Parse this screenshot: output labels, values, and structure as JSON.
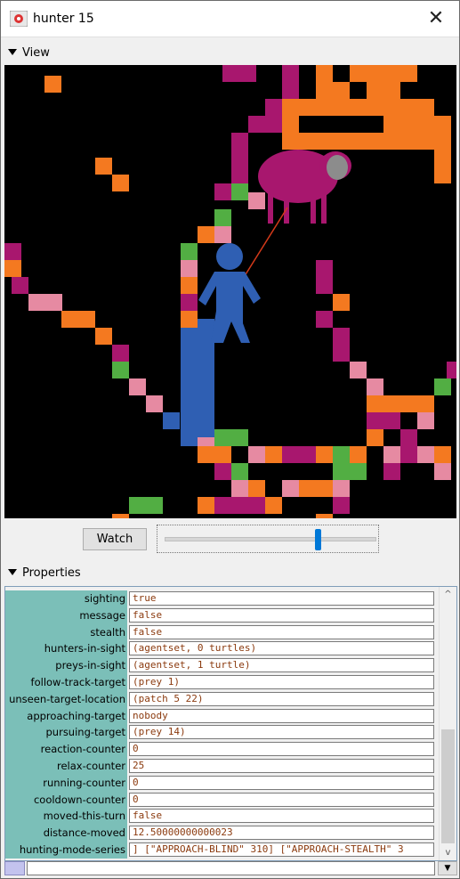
{
  "window": {
    "title": "hunter 15",
    "close_label": "✕"
  },
  "view_section": {
    "label": "View"
  },
  "controls": {
    "watch_label": "Watch",
    "slider_value": 0.73
  },
  "properties_section": {
    "label": "Properties"
  },
  "properties": [
    {
      "name": "sighting",
      "value": "true"
    },
    {
      "name": "message",
      "value": "false"
    },
    {
      "name": "stealth",
      "value": "false"
    },
    {
      "name": "hunters-in-sight",
      "value": "(agentset, 0 turtles)"
    },
    {
      "name": "preys-in-sight",
      "value": "(agentset, 1 turtle)"
    },
    {
      "name": "follow-track-target",
      "value": "(prey 1)"
    },
    {
      "name": "unseen-target-location",
      "value": "(patch 5 22)"
    },
    {
      "name": "approaching-target",
      "value": "nobody"
    },
    {
      "name": "pursuing-target",
      "value": "(prey 14)"
    },
    {
      "name": "reaction-counter",
      "value": "0"
    },
    {
      "name": "relax-counter",
      "value": "25"
    },
    {
      "name": "running-counter",
      "value": "0"
    },
    {
      "name": "cooldown-counter",
      "value": "0"
    },
    {
      "name": "moved-this-turn",
      "value": "false"
    },
    {
      "name": "distance-moved",
      "value": "12.50000000000023"
    },
    {
      "name": "hunting-mode-series",
      "value": "] [\"APPROACH-BLIND\" 310] [\"APPROACH-STEALTH\" 3"
    }
  ],
  "colors": {
    "orange": "#f47920",
    "magenta": "#a8176e",
    "pink": "#e68aa2",
    "green": "#52ae43",
    "blue": "#2f5fb3",
    "prey": "#a8176e",
    "prey_head": "#8c8c8c",
    "label_bg": "#7bbfb8"
  },
  "icons": {
    "app": "netlogo-turtle-icon",
    "close": "close-icon",
    "collapse": "triangle-down-icon"
  }
}
